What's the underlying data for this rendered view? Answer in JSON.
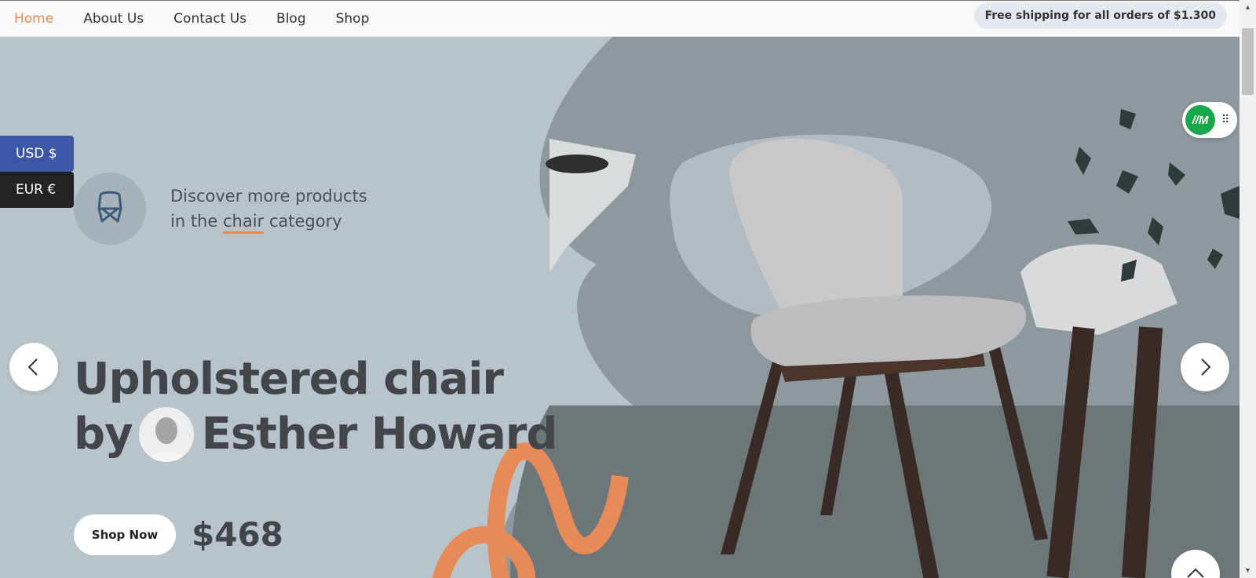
{
  "nav": {
    "items": [
      {
        "label": "Home",
        "active": true
      },
      {
        "label": "About Us",
        "active": false
      },
      {
        "label": "Contact Us",
        "active": false
      },
      {
        "label": "Blog",
        "active": false
      },
      {
        "label": "Shop",
        "active": false
      }
    ],
    "promo": "Free shipping for all orders of $1.300"
  },
  "currency": {
    "usd": "USD $",
    "eur": "EUR €"
  },
  "category": {
    "line1": "Discover more products",
    "line2_prefix": "in the ",
    "line2_word": "chair",
    "line2_suffix": " category",
    "icon": "chair-icon"
  },
  "hero": {
    "line1": "Upholstered chair",
    "line2_prefix": "by",
    "line2_name": "Esther Howard",
    "button": "Shop Now",
    "price": "$468"
  },
  "badge": {
    "logo": "//M",
    "dots": "⠿"
  },
  "colors": {
    "accent": "#e68b58",
    "hero_bg": "#b9c4ca",
    "usd_bg": "#3b57a6",
    "eur_bg": "#232323",
    "badge_green": "#1aa64a"
  }
}
